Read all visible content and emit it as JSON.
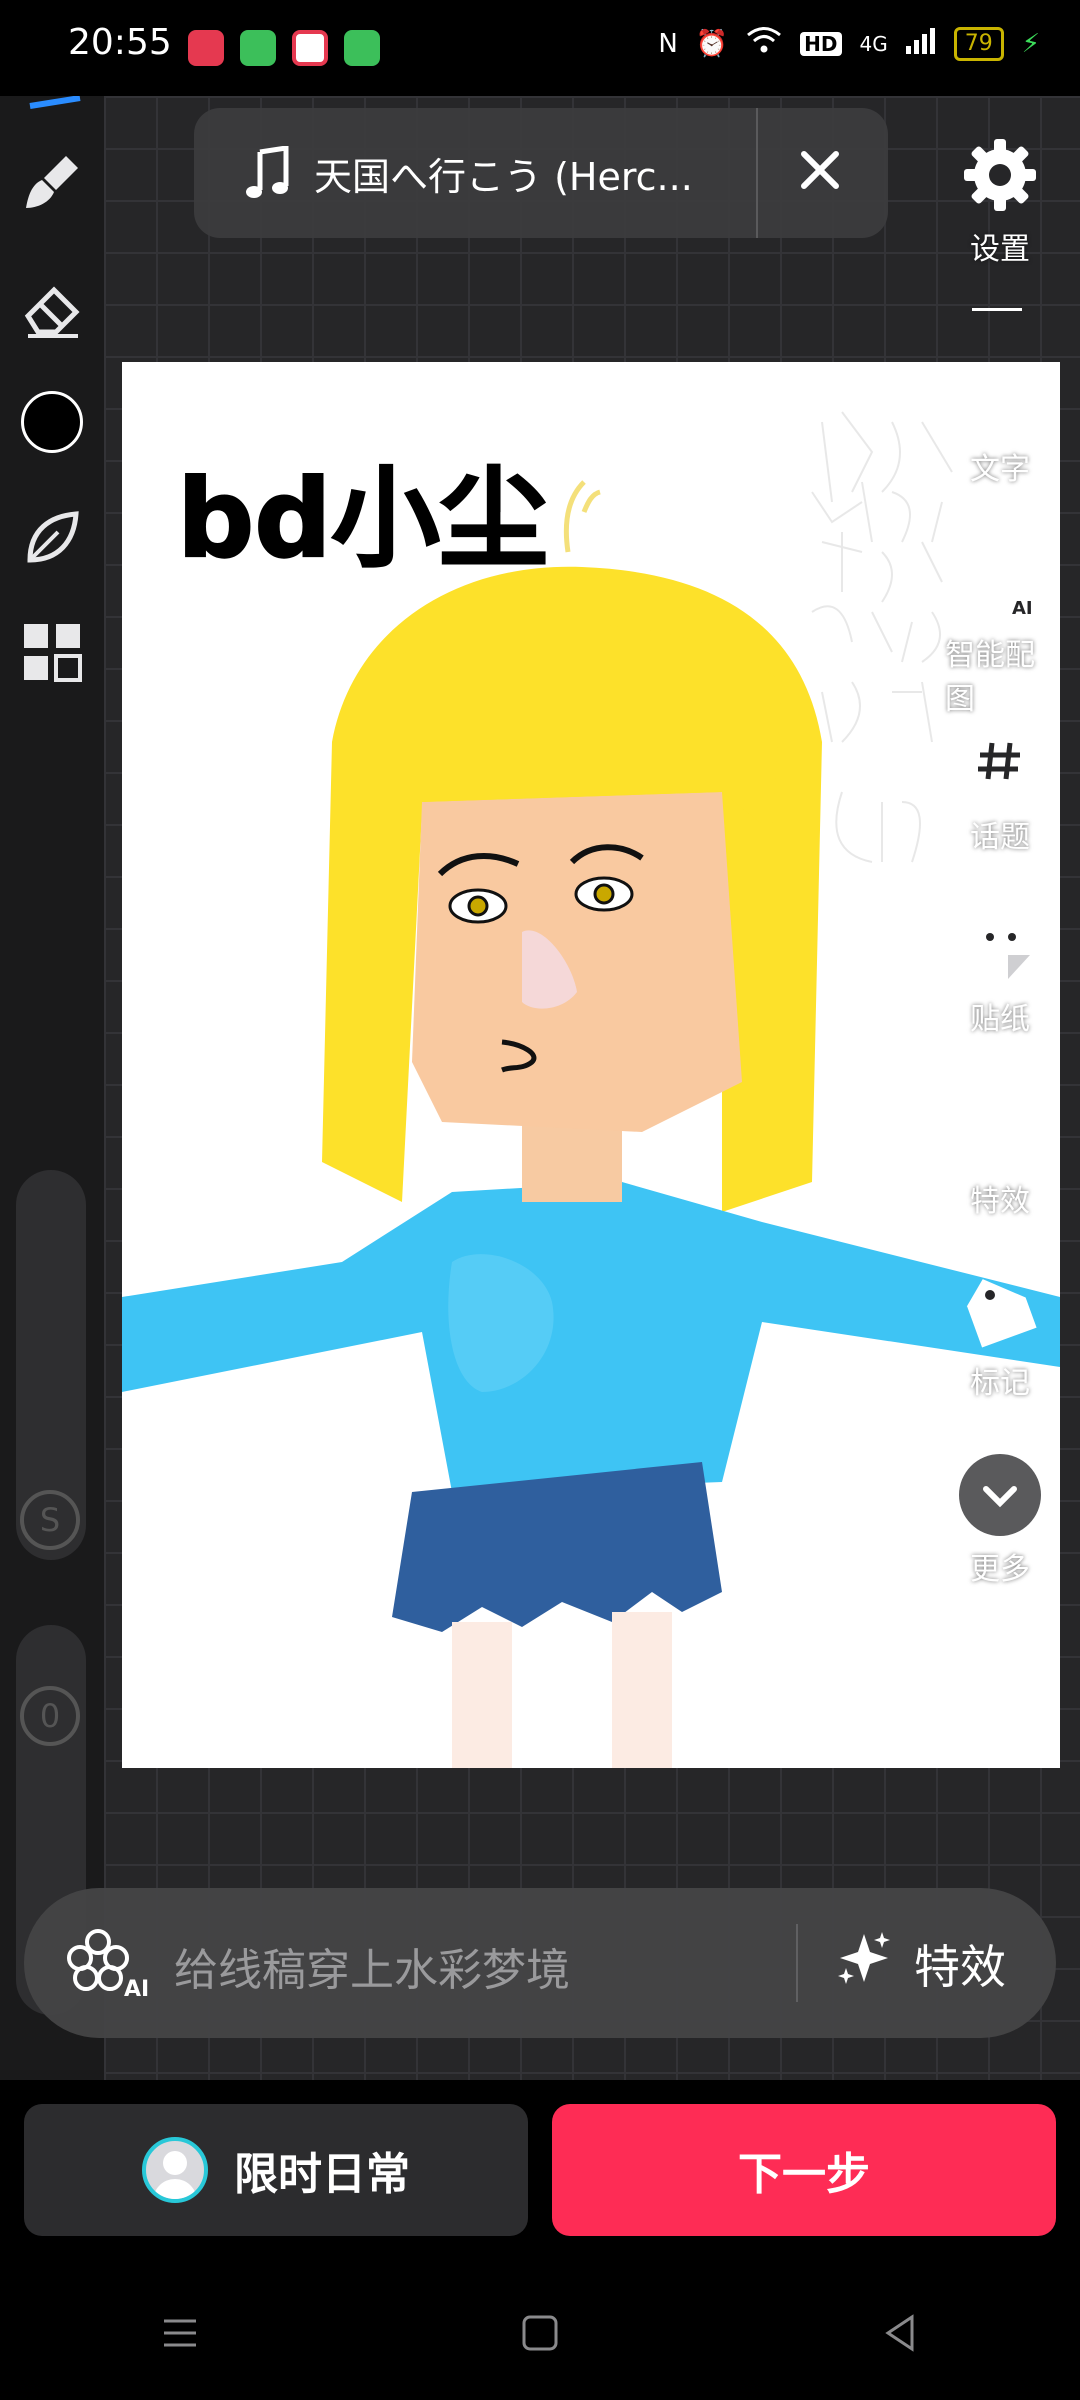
{
  "status_bar": {
    "time": "20:55",
    "network": "4G",
    "hd": "HD",
    "battery": "79"
  },
  "music": {
    "title": "天国へ行こう (Herc..."
  },
  "settings": {
    "label": "设置"
  },
  "canvas": {
    "title": "bd小尘"
  },
  "right_tools": {
    "text": "文字",
    "smart_image": "智能配图",
    "topic": "话题",
    "sticker": "贴纸",
    "effects": "特效",
    "tag": "标记",
    "more": "更多"
  },
  "left_tools": {
    "slider_top_label": "S",
    "slider_bottom_value": "0"
  },
  "ai_bar": {
    "placeholder": "给线稿穿上水彩梦境",
    "effect_label": "特效"
  },
  "bottom": {
    "daily_label": "限时日常",
    "next_label": "下一步"
  },
  "colors": {
    "accent": "#fe2c55",
    "brush_color": "#000000"
  }
}
